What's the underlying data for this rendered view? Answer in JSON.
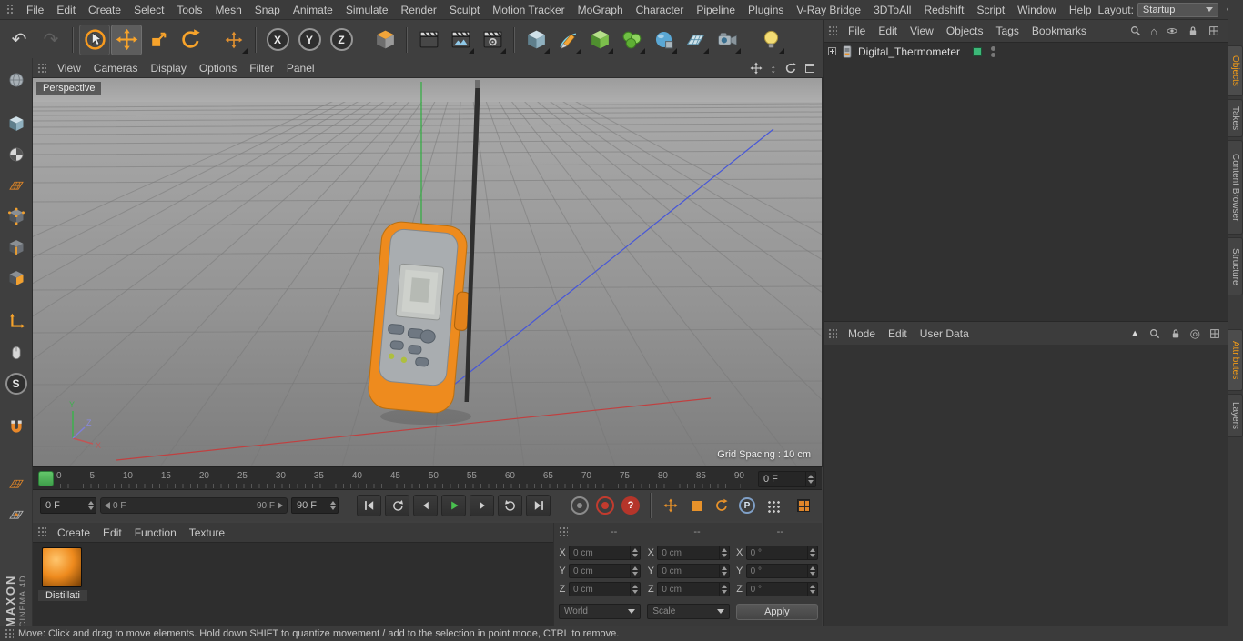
{
  "colors": {
    "accent_orange": "#f79a1f",
    "play_green": "#49c04f",
    "marker_green": "#4fb45a",
    "axis_x_red": "#c04040",
    "axis_y_green": "#2fae3f",
    "axis_z_blue": "#4757d8",
    "layer_green": "#3cb878",
    "panel_bg": "#3c3c3c",
    "viewport_gray": "#8f8f8f"
  },
  "icons": {
    "undo": "↶",
    "redo": "↷",
    "home": "⌂",
    "dolly": "↕",
    "target": "◎",
    "up_triangle": "▲"
  },
  "menubar": {
    "items": [
      "File",
      "Edit",
      "Create",
      "Select",
      "Tools",
      "Mesh",
      "Snap",
      "Animate",
      "Simulate",
      "Render",
      "Sculpt",
      "Motion Tracker",
      "MoGraph",
      "Character",
      "Pipeline",
      "Plugins",
      "V-Ray Bridge",
      "3DToAll",
      "Redshift",
      "Script",
      "Window",
      "Help"
    ],
    "layout_label": "Layout:",
    "layout_value": "Startup"
  },
  "toolbar": {
    "axis_locks": [
      "X",
      "Y",
      "Z"
    ]
  },
  "left_toolbar": {
    "solo_label": "S"
  },
  "viewport": {
    "menu": [
      "View",
      "Cameras",
      "Display",
      "Options",
      "Filter",
      "Panel"
    ],
    "camera_label": "Perspective",
    "grid_spacing": "Grid Spacing : 10 cm",
    "axis": {
      "x": "X",
      "y": "Y",
      "z": "Z"
    }
  },
  "object_manager": {
    "menu": [
      "File",
      "Edit",
      "View",
      "Objects",
      "Tags",
      "Bookmarks"
    ],
    "objects": [
      {
        "name": "Digital_Thermometer"
      }
    ]
  },
  "attribute_manager": {
    "menu": [
      "Mode",
      "Edit",
      "User Data"
    ]
  },
  "tabs": {
    "top": [
      "Objects",
      "Takes",
      "Content Browser",
      "Structure"
    ],
    "bottom": [
      "Attributes",
      "Layers"
    ]
  },
  "timeline": {
    "ticks": [
      "0",
      "5",
      "10",
      "15",
      "20",
      "25",
      "30",
      "35",
      "40",
      "45",
      "50",
      "55",
      "60",
      "65",
      "70",
      "75",
      "80",
      "85",
      "90"
    ],
    "current_frame": "0 F"
  },
  "playback": {
    "start_frame": "0 F",
    "range_start": "0 F",
    "range_end": "90 F",
    "end_frame": "90 F",
    "p_label": "P",
    "help_label": "?"
  },
  "material_manager": {
    "menu": [
      "Create",
      "Edit",
      "Function",
      "Texture"
    ],
    "materials": [
      {
        "name": "Distillati"
      }
    ]
  },
  "coordinates": {
    "headers": [
      "--",
      "--",
      "--"
    ],
    "axis_labels": [
      "X",
      "Y",
      "Z"
    ],
    "position": [
      "0 cm",
      "0 cm",
      "0 cm"
    ],
    "size": [
      "0 cm",
      "0 cm",
      "0 cm"
    ],
    "rotation": [
      "0 °",
      "0 °",
      "0 °"
    ],
    "space_dropdown": "World",
    "mode_dropdown": "Scale",
    "apply_button": "Apply"
  },
  "statusbar": {
    "text": "Move: Click and drag to move elements. Hold down SHIFT to quantize movement / add to the selection in point mode, CTRL to remove."
  },
  "branding": {
    "maxon": "MAXON",
    "cinema": "CINEMA 4D"
  }
}
